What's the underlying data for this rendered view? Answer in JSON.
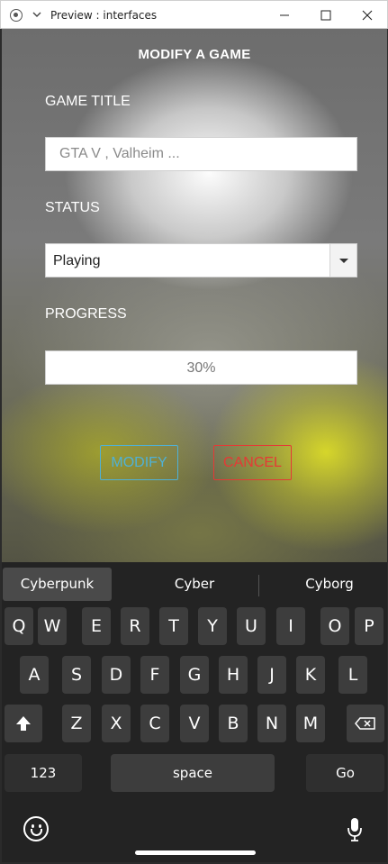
{
  "window": {
    "title": "Preview : interfaces"
  },
  "form": {
    "heading": "MODIFY A GAME",
    "game_title_label": "GAME TITLE",
    "game_title_placeholder": "GTA V , Valheim ...",
    "status_label": "STATUS",
    "status_value": "Playing",
    "progress_label": "PROGRESS",
    "progress_value": "30%",
    "modify_label": "MODIFY",
    "cancel_label": "CANCEL"
  },
  "colors": {
    "modify": "#4fb1d6",
    "cancel": "#e53935",
    "keyboard_bg": "#232323"
  },
  "keyboard": {
    "suggestions": [
      "Cyberpunk",
      "Cyber",
      "Cyborg"
    ],
    "row1": [
      "Q",
      "W",
      "E",
      "R",
      "T",
      "Y",
      "U",
      "I",
      "O",
      "P"
    ],
    "row2": [
      "A",
      "S",
      "D",
      "F",
      "G",
      "H",
      "J",
      "K",
      "L"
    ],
    "row3": [
      "Z",
      "X",
      "C",
      "V",
      "B",
      "N",
      "M"
    ],
    "numbers_label": "123",
    "space_label": "space",
    "go_label": "Go",
    "icons": [
      "shift-icon",
      "backspace-icon",
      "emoji-icon",
      "microphone-icon"
    ]
  }
}
